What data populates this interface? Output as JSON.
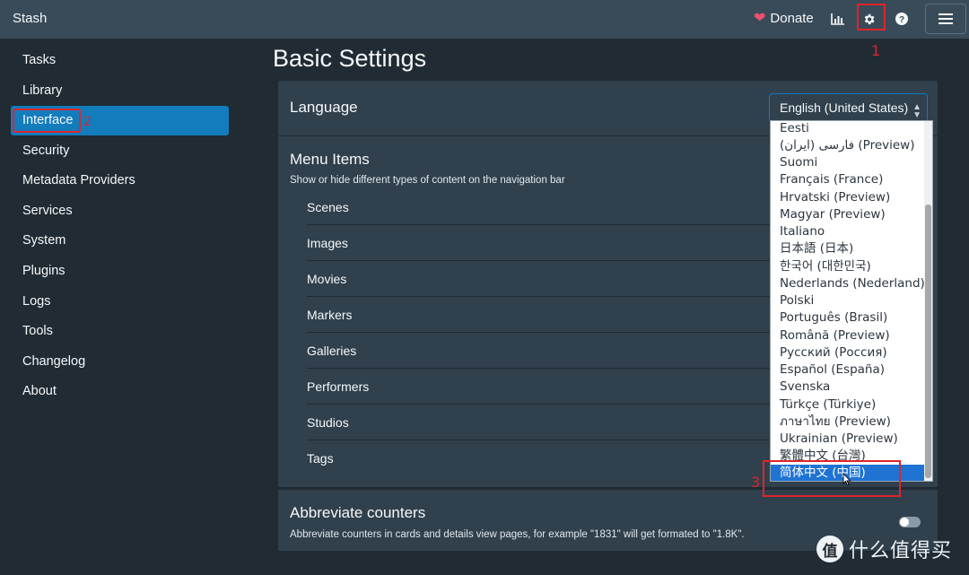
{
  "navbar": {
    "brand": "Stash",
    "donate_label": "Donate",
    "icons": [
      "heart-icon",
      "bar-chart-icon",
      "gear-icon",
      "help-icon",
      "hamburger-icon"
    ]
  },
  "annotations": {
    "n1": "1",
    "n2": "2",
    "n3": "3"
  },
  "sidebar": {
    "items": [
      {
        "label": "Tasks"
      },
      {
        "label": "Library"
      },
      {
        "label": "Interface",
        "active": true
      },
      {
        "label": "Security"
      },
      {
        "label": "Metadata Providers"
      },
      {
        "label": "Services"
      },
      {
        "label": "System"
      },
      {
        "label": "Plugins"
      },
      {
        "label": "Logs"
      },
      {
        "label": "Tools"
      },
      {
        "label": "Changelog"
      },
      {
        "label": "About"
      }
    ]
  },
  "main": {
    "title": "Basic Settings",
    "language": {
      "label": "Language",
      "selected": "English (United States)",
      "options": [
        "Eesti",
        "فارسی (ایران) (Preview)",
        "Suomi",
        "Français (France)",
        "Hrvatski (Preview)",
        "Magyar (Preview)",
        "Italiano",
        "日本語 (日本)",
        "한국어 (대한민국)",
        "Nederlands (Nederland)",
        "Polski",
        "Português (Brasil)",
        "Română (Preview)",
        "Русский (Россия)",
        "Español (España)",
        "Svenska",
        "Türkçe (Türkiye)",
        "ภาษาไทย (Preview)",
        "Ukrainian (Preview)",
        "繁體中文 (台灣)",
        "简体中文 (中国)"
      ],
      "highlighted": "简体中文 (中国)"
    },
    "menu_items": {
      "title": "Menu Items",
      "description": "Show or hide different types of content on the navigation bar",
      "rows": [
        "Scenes",
        "Images",
        "Movies",
        "Markers",
        "Galleries",
        "Performers",
        "Studios",
        "Tags"
      ]
    },
    "abbreviate": {
      "title": "Abbreviate counters",
      "description": "Abbreviate counters in cards and details view pages, for example \"1831\" will get formated to \"1.8K\".",
      "enabled": false
    }
  },
  "watermark": {
    "logo": "值",
    "text": "什么值得买"
  },
  "colors": {
    "navbar": "#394b59",
    "background": "#202b33",
    "card": "#30404d",
    "accent": "#137cbd",
    "annotation_red": "#e0242b",
    "heart": "#f0506e"
  }
}
